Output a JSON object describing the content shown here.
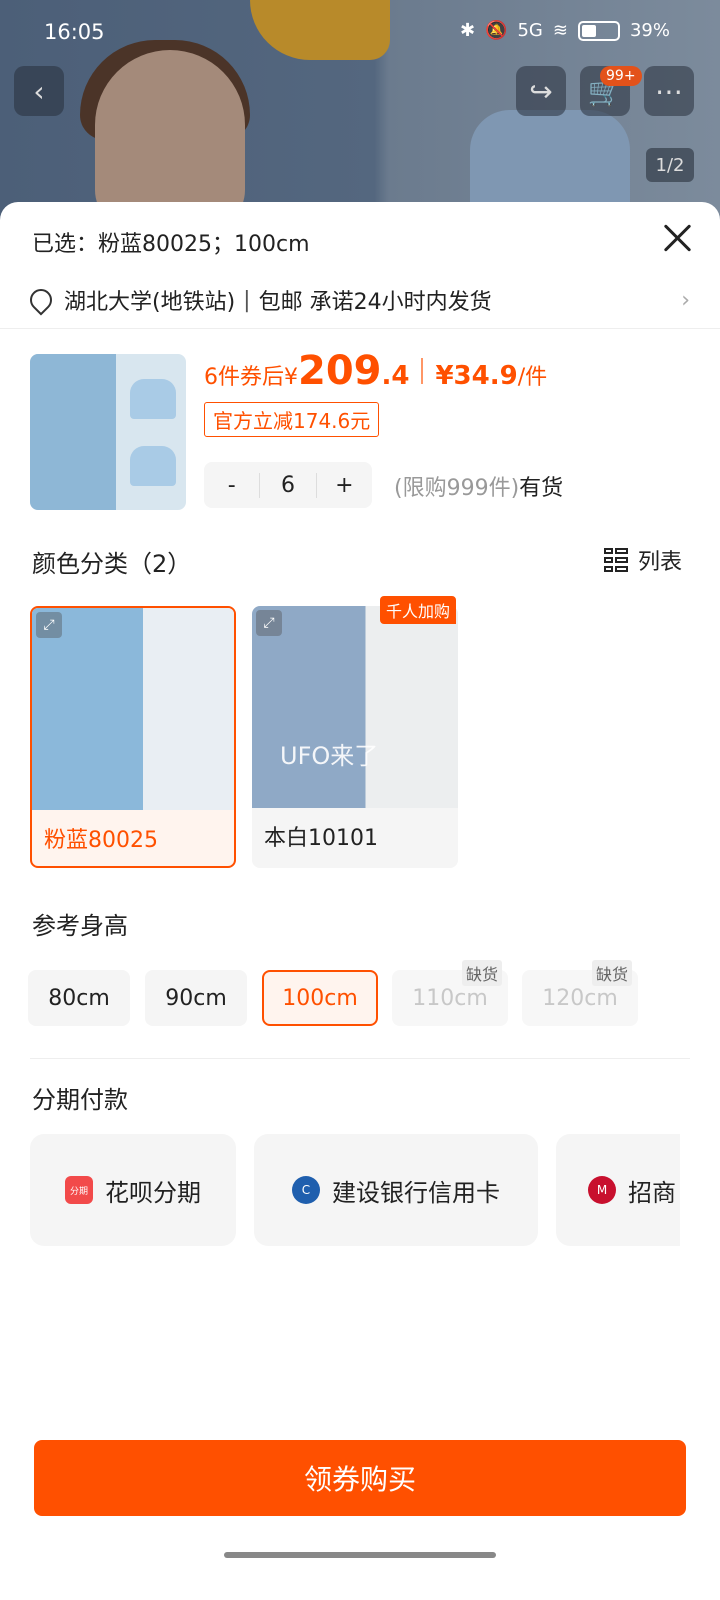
{
  "status_bar": {
    "time": "16:05",
    "signal": "5G",
    "battery": "39%"
  },
  "gallery": {
    "pager": "1/2",
    "cart_badge": "99+"
  },
  "sheet": {
    "selected_label": "已选：粉蓝80025；100cm",
    "location": "湖北大学(地铁站)",
    "shipping": "包邮 承诺24小时内发货"
  },
  "price": {
    "prefix": "6件券后",
    "currency": "¥",
    "integer": "209",
    "decimal": ".4",
    "per_unit": "¥34.9",
    "per_unit_suffix": "/件",
    "coupon": "官方立减174.6元"
  },
  "quantity": {
    "minus": "-",
    "value": "6",
    "plus": "+",
    "limit": "(限购999件)",
    "stock": "有货"
  },
  "color_section": {
    "title": "颜色分类（2）",
    "list_label": "列表",
    "items": [
      {
        "label": "粉蓝80025",
        "selected": true
      },
      {
        "label": "本白10101",
        "selected": false,
        "tag": "千人加购",
        "overlay": "UFO来了"
      }
    ]
  },
  "size_section": {
    "title": "参考身高",
    "items": [
      {
        "label": "80cm",
        "state": "normal"
      },
      {
        "label": "90cm",
        "state": "normal"
      },
      {
        "label": "100cm",
        "state": "selected"
      },
      {
        "label": "110cm",
        "state": "oos",
        "tag": "缺货"
      },
      {
        "label": "120cm",
        "state": "oos",
        "tag": "缺货"
      }
    ]
  },
  "installment_section": {
    "title": "分期付款",
    "items": [
      {
        "label": "花呗分期",
        "icon": "huabei-icon",
        "icon_text": "分期"
      },
      {
        "label": "建设银行信用卡",
        "icon": "ccb-icon"
      },
      {
        "label": "招商",
        "icon": "cmb-icon"
      }
    ]
  },
  "buy_button": "领券购买",
  "colors": {
    "accent": "#ff5000"
  }
}
